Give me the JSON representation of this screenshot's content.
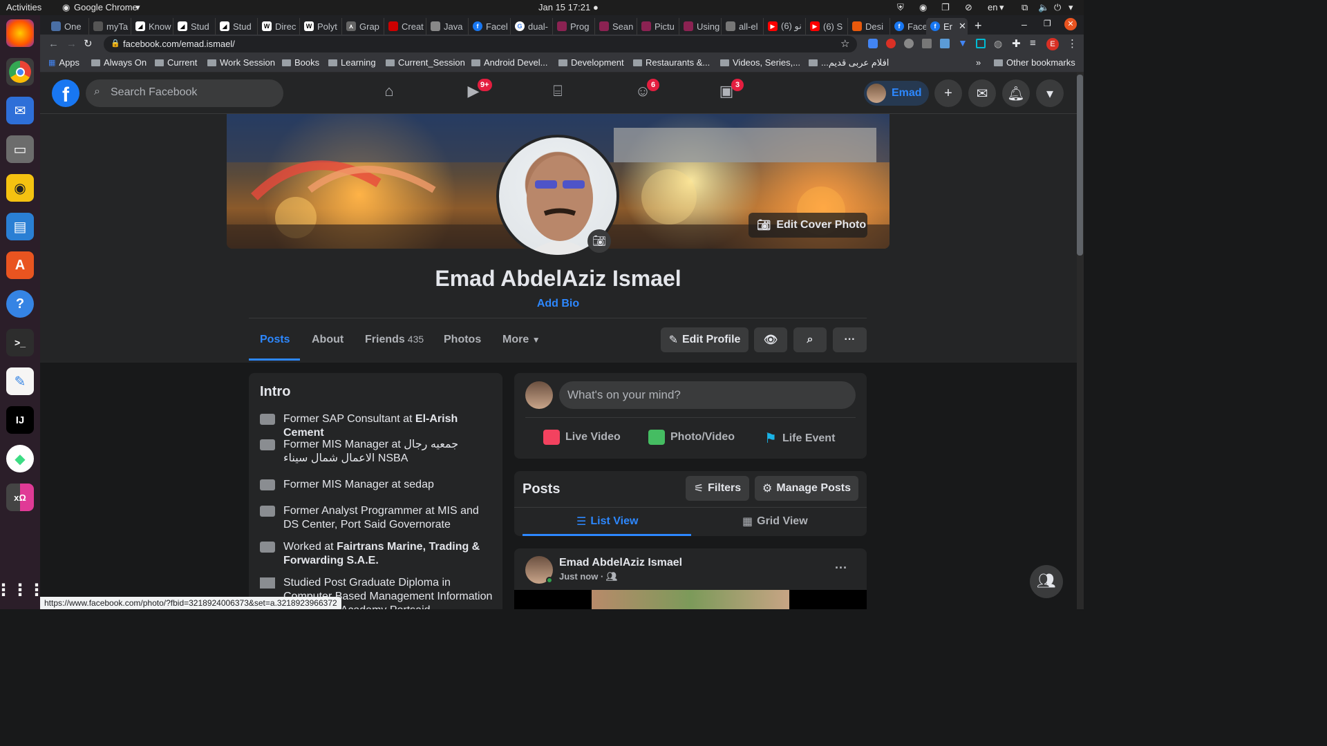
{
  "system": {
    "activities": "Activities",
    "app_name": "Google Chrome",
    "clock": "Jan 15  17:21",
    "lang": "en"
  },
  "tabs": [
    {
      "label": "One"
    },
    {
      "label": "myTa"
    },
    {
      "label": "Know"
    },
    {
      "label": "Stud"
    },
    {
      "label": "Stud"
    },
    {
      "label": "Direc"
    },
    {
      "label": "Polyt"
    },
    {
      "label": "Grap"
    },
    {
      "label": "Creat"
    },
    {
      "label": "Java"
    },
    {
      "label": "Facel"
    },
    {
      "label": "dual-"
    },
    {
      "label": "Prog"
    },
    {
      "label": "Sean"
    },
    {
      "label": "Pictu"
    },
    {
      "label": "Using"
    },
    {
      "label": "all-el"
    },
    {
      "label": "(6) نو"
    },
    {
      "label": "(6) S"
    },
    {
      "label": "Desi"
    },
    {
      "label": "Facel"
    },
    {
      "label": "Er"
    }
  ],
  "address": {
    "url": "facebook.com/emad.ismael/"
  },
  "bookmarks": {
    "apps": "Apps",
    "items": [
      "Always On",
      "Current",
      "Work Session",
      "Books",
      "Learning",
      "Current_Session",
      "Android Devel...",
      "Development",
      "Restaurants &...",
      "Videos, Series,...",
      "...افلام عربى قديم"
    ],
    "more": "»",
    "other": "Other bookmarks"
  },
  "fb": {
    "search_placeholder": "Search Facebook",
    "watch_badge": "9+",
    "groups_badge": "6",
    "gaming_badge": "3",
    "user_short": "Emad"
  },
  "profile": {
    "edit_cover": "Edit Cover Photo",
    "name": "Emad AbdelAziz Ismael",
    "add_bio": "Add Bio",
    "tabs": {
      "posts": "Posts",
      "about": "About",
      "friends": "Friends",
      "friends_count": "435",
      "photos": "Photos",
      "more": "More"
    },
    "edit_profile": "Edit Profile"
  },
  "intro": {
    "title": "Intro",
    "items": [
      {
        "text": "Former SAP Consultant at ",
        "bold": "El-Arish Cement"
      },
      {
        "text": "Former MIS Manager at جمعيه رجال الاعمال شمال سيناء NSBA",
        "bold": ""
      },
      {
        "text": "Former MIS Manager at sedap",
        "bold": ""
      },
      {
        "text": "Former Analyst Programmer at MIS and DS Center, Port Said Governorate",
        "bold": ""
      },
      {
        "text": "Worked at ",
        "bold": "Fairtrans Marine, Trading & Forwarding S.A.E."
      },
      {
        "text": "Studied Post Graduate Diploma in Computer Based Management Information Systems at Academy Portsaid",
        "bold": ""
      }
    ]
  },
  "composer": {
    "placeholder": "What's on your mind?",
    "live": "Live Video",
    "photo": "Photo/Video",
    "life": "Life Event"
  },
  "posts": {
    "title": "Posts",
    "filters": "Filters",
    "manage": "Manage Posts",
    "list_view": "List View",
    "grid_view": "Grid View",
    "post_author": "Emad AbdelAziz Ismael",
    "post_time": "Just now ·"
  },
  "status_url": "https://www.facebook.com/photo/?fbid=3218924006373&set=a.3218923966372",
  "colors": {
    "fb_blue": "#1877f2",
    "link_blue": "#2d88ff",
    "badge_red": "#e41e3f",
    "surface": "#242526",
    "background": "#18191a"
  }
}
